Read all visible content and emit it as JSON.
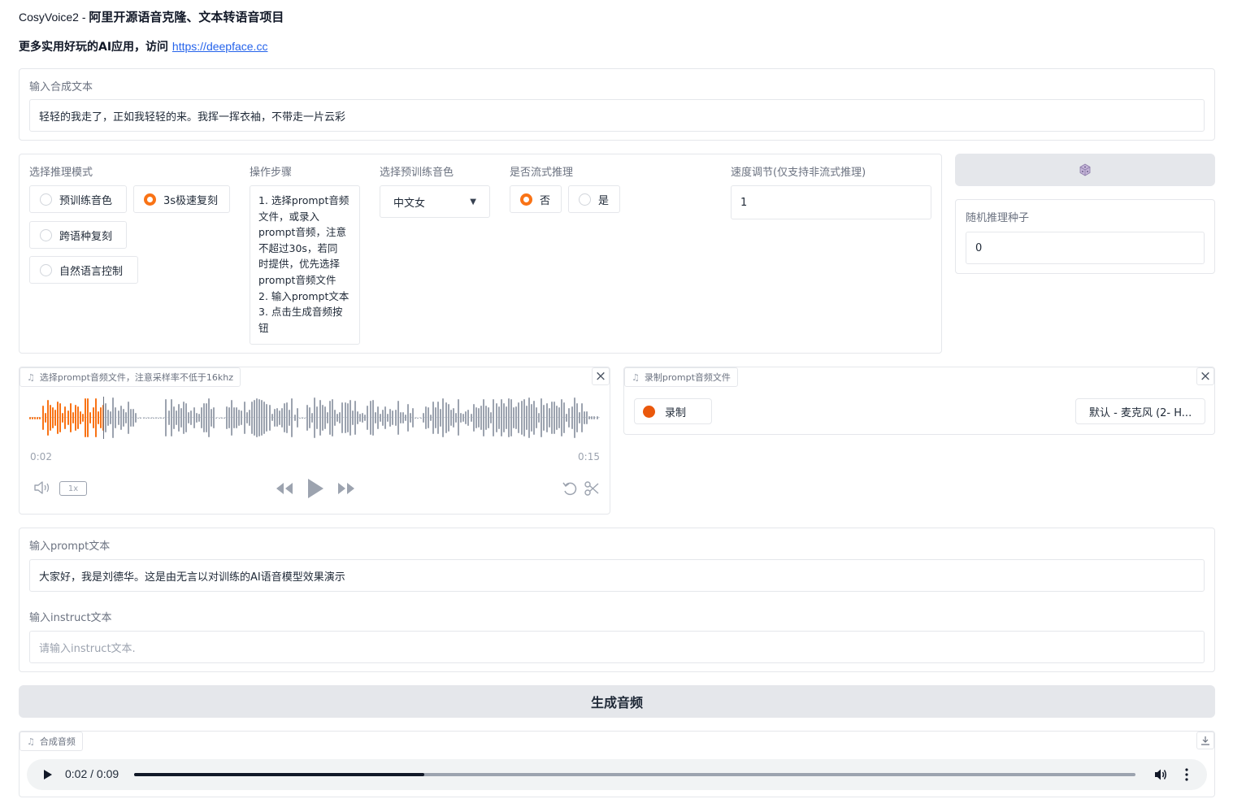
{
  "header": {
    "app_name": "CosyVoice2 - ",
    "title": "阿里开源语音克隆、文本转语音项目",
    "subtitle_prefix": "更多实用好玩的AI应用，访问 ",
    "subtitle_link": "https://deepface.cc"
  },
  "synth_text": {
    "label": "输入合成文本",
    "value": "轻轻的我走了，正如我轻轻的来。我挥一挥衣袖，不带走一片云彩"
  },
  "mode": {
    "label": "选择推理模式",
    "options": [
      "预训练音色",
      "3s极速复刻",
      "跨语种复刻",
      "自然语言控制"
    ],
    "selected": "3s极速复刻"
  },
  "steps": {
    "label": "操作步骤",
    "lines": [
      "1. 选择prompt音频",
      "文件，或录入",
      "prompt音频，注意",
      "不超过30s，若同",
      "时提供，优先选择",
      "prompt音频文件",
      "2. 输入prompt文本",
      "3. 点击生成音频按",
      "钮"
    ]
  },
  "voice": {
    "label": "选择预训练音色",
    "value": "中文女"
  },
  "stream": {
    "label": "是否流式推理",
    "options": [
      "否",
      "是"
    ],
    "selected": "否"
  },
  "speed": {
    "label": "速度调节(仅支持非流式推理)",
    "value": "1"
  },
  "dice_button": {
    "icon": "dice-icon"
  },
  "seed": {
    "label": "随机推理种子",
    "value": "0"
  },
  "prompt_audio": {
    "label": "选择prompt音频文件，注意采样率不低于16khz",
    "current_time": "0:02",
    "duration": "0:15",
    "playback_rate": "1x",
    "progress": 0.13
  },
  "record": {
    "label": "录制prompt音频文件",
    "record_button": "录制",
    "device": "默认 - 麦克风 (2- H..."
  },
  "prompt_text": {
    "label": "输入prompt文本",
    "value": "大家好，我是刘德华。这是由无言以对训练的AI语音模型效果演示"
  },
  "instruct_text": {
    "label": "输入instruct文本",
    "placeholder": "请输入instruct文本."
  },
  "generate_button": "生成音频",
  "output_audio": {
    "label": "合成音频",
    "time": "0:02 / 0:09",
    "progress": 0.29
  },
  "colors": {
    "accent": "#f97316",
    "wave_played": "#f97316",
    "wave_unplayed": "#9ca3af",
    "button_bg": "#e5e7eb",
    "link": "#2563eb"
  }
}
